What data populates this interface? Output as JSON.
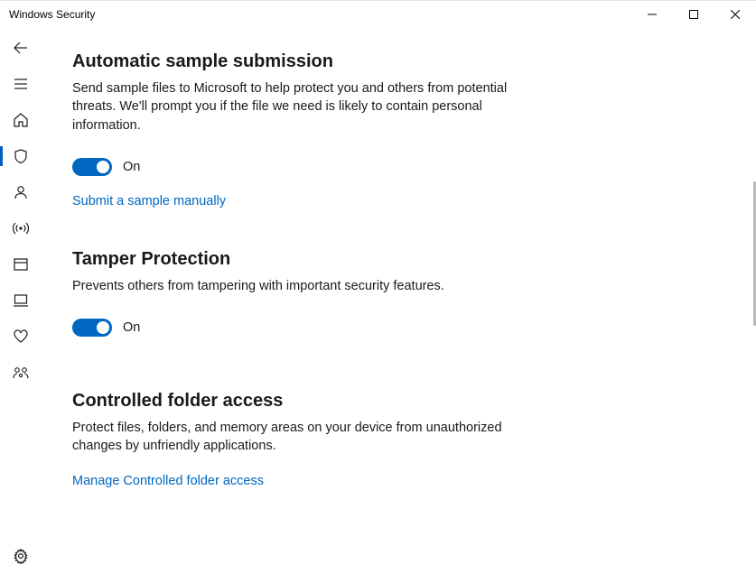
{
  "window": {
    "title": "Windows Security"
  },
  "sections": {
    "auto_sample": {
      "heading": "Automatic sample submission",
      "desc": "Send sample files to Microsoft to help protect you and others from potential threats.  We'll prompt you if the file we need is likely to contain personal information.",
      "toggle_state": "On",
      "link": "Submit a sample manually"
    },
    "tamper": {
      "heading": "Tamper Protection",
      "desc": "Prevents others from tampering with important security features.",
      "toggle_state": "On"
    },
    "cfa": {
      "heading": "Controlled folder access",
      "desc": "Protect files, folders, and memory areas on your device from unauthorized changes by unfriendly applications.",
      "link": "Manage Controlled folder access"
    }
  }
}
